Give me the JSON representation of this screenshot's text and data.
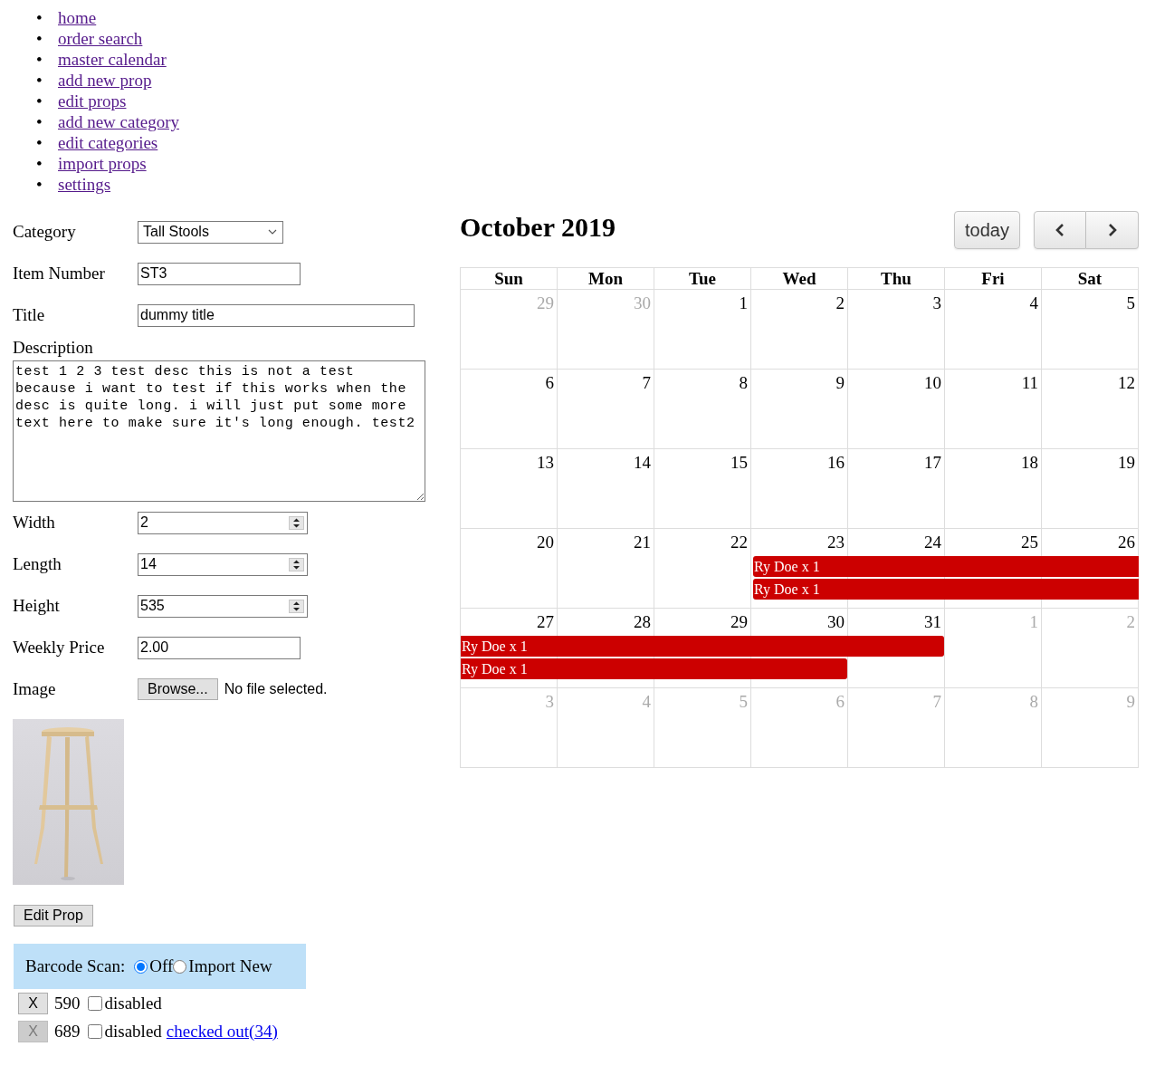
{
  "nav": [
    {
      "marker": "•",
      "label": "home",
      "visited": true
    },
    {
      "marker": "•",
      "label": "order search",
      "visited": true
    },
    {
      "marker": "•",
      "label": "master calendar",
      "visited": true
    },
    {
      "marker": "•",
      "label": "add new prop",
      "visited": true
    },
    {
      "marker": "•",
      "label": "edit props",
      "visited": true
    },
    {
      "marker": "•",
      "label": "add new category",
      "visited": true
    },
    {
      "marker": "•",
      "label": "edit categories",
      "visited": true
    },
    {
      "marker": "•",
      "label": "import props",
      "visited": true
    },
    {
      "marker": "•",
      "label": "settings",
      "visited": true
    }
  ],
  "form": {
    "fields": [
      {
        "kind": "select",
        "label": "Category",
        "value": "Tall Stools"
      },
      {
        "kind": "text",
        "label": "Item Number",
        "value": "ST3"
      },
      {
        "kind": "text",
        "label": "Title",
        "value": "dummy title"
      },
      {
        "kind": "textarea",
        "label": "Description",
        "value": "test 1 2 3 test desc this is not a test because i want to test if this works when the desc is quite long. i will just put some more text here to make sure it's long enough. test2"
      },
      {
        "kind": "number",
        "label": "Width",
        "value": "2"
      },
      {
        "kind": "number",
        "label": "Length",
        "value": "14"
      },
      {
        "kind": "number",
        "label": "Height",
        "value": "535"
      },
      {
        "kind": "text",
        "label": "Weekly Price",
        "value": "2.00"
      },
      {
        "kind": "file",
        "label": "Image",
        "button": "Browse...",
        "status": "No file selected."
      }
    ],
    "submit": "Edit Prop"
  },
  "barcode": {
    "label": "Barcode Scan:",
    "options": [
      {
        "label": "Off",
        "selected": true
      },
      {
        "label": "Import New",
        "selected": false
      }
    ]
  },
  "items": [
    {
      "button": "X",
      "button_disabled": false,
      "number": "590",
      "checked": false,
      "checkbox_label": "disabled"
    },
    {
      "button": "X",
      "button_disabled": true,
      "number": "689",
      "checked": false,
      "checkbox_label": "disabled",
      "link": {
        "label": "checked out(34)",
        "visited": false
      }
    }
  ],
  "calendar": {
    "title": "October 2019",
    "today_button": "today",
    "weekdays": [
      "Sun",
      "Mon",
      "Tue",
      "Wed",
      "Thu",
      "Fri",
      "Sat"
    ],
    "weeks": [
      {
        "days": [
          {
            "n": "29",
            "other_month": true
          },
          {
            "n": "30",
            "other_month": true
          },
          {
            "n": "1",
            "other_month": false
          },
          {
            "n": "2",
            "other_month": false
          },
          {
            "n": "3",
            "other_month": false
          },
          {
            "n": "4",
            "other_month": false
          },
          {
            "n": "5",
            "other_month": false
          }
        ]
      },
      {
        "days": [
          {
            "n": "6",
            "other_month": false
          },
          {
            "n": "7",
            "other_month": false
          },
          {
            "n": "8",
            "other_month": false
          },
          {
            "n": "9",
            "other_month": false
          },
          {
            "n": "10",
            "other_month": false
          },
          {
            "n": "11",
            "other_month": false
          },
          {
            "n": "12",
            "other_month": false
          }
        ]
      },
      {
        "days": [
          {
            "n": "13",
            "other_month": false
          },
          {
            "n": "14",
            "other_month": false
          },
          {
            "n": "15",
            "other_month": false
          },
          {
            "n": "16",
            "other_month": false
          },
          {
            "n": "17",
            "other_month": false
          },
          {
            "n": "18",
            "other_month": false
          },
          {
            "n": "19",
            "other_month": false
          }
        ]
      },
      {
        "days": [
          {
            "n": "20",
            "other_month": false
          },
          {
            "n": "21",
            "other_month": false
          },
          {
            "n": "22",
            "other_month": false
          },
          {
            "n": "23",
            "other_month": false
          },
          {
            "n": "24",
            "other_month": false
          },
          {
            "n": "25",
            "other_month": false
          },
          {
            "n": "26",
            "other_month": false
          }
        ],
        "events": [
          {
            "title": "Ry Doe x 1",
            "color": "#cc0000",
            "covers": [
              false,
              false,
              false,
              true,
              true,
              true,
              true
            ]
          },
          {
            "title": "Ry Doe x 1",
            "color": "#cc0000",
            "covers": [
              false,
              false,
              false,
              true,
              true,
              true,
              true
            ]
          }
        ]
      },
      {
        "days": [
          {
            "n": "27",
            "other_month": false
          },
          {
            "n": "28",
            "other_month": false
          },
          {
            "n": "29",
            "other_month": false
          },
          {
            "n": "30",
            "other_month": false
          },
          {
            "n": "31",
            "other_month": false
          },
          {
            "n": "1",
            "other_month": true
          },
          {
            "n": "2",
            "other_month": true
          }
        ],
        "events": [
          {
            "title": "Ry Doe x 1",
            "color": "#cc0000",
            "covers": [
              true,
              true,
              true,
              true,
              true,
              false,
              false
            ]
          },
          {
            "title": "Ry Doe x 1",
            "color": "#cc0000",
            "covers": [
              true,
              true,
              true,
              true,
              false,
              false,
              false
            ]
          }
        ]
      },
      {
        "days": [
          {
            "n": "3",
            "other_month": true
          },
          {
            "n": "4",
            "other_month": true
          },
          {
            "n": "5",
            "other_month": true
          },
          {
            "n": "6",
            "other_month": true
          },
          {
            "n": "7",
            "other_month": true
          },
          {
            "n": "8",
            "other_month": true
          },
          {
            "n": "9",
            "other_month": true
          }
        ]
      }
    ]
  }
}
